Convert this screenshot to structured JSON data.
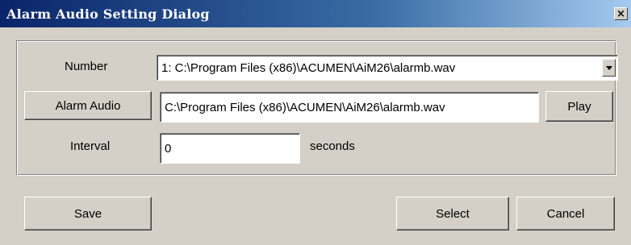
{
  "window": {
    "title": "Alarm Audio Setting Dialog",
    "close_glyph": "×",
    "close_icon": "close-icon"
  },
  "form": {
    "number_label": "Number",
    "number_selected": "1: C:\\Program Files (x86)\\ACUMEN\\AiM26\\alarmb.wav",
    "dropdown_icon": "chevron-down-icon",
    "alarm_audio_button": "Alarm Audio",
    "alarm_audio_path": "C:\\Program Files (x86)\\ACUMEN\\AiM26\\alarmb.wav",
    "play_button": "Play",
    "interval_label": "Interval",
    "interval_value": "0",
    "interval_unit": "seconds"
  },
  "footer": {
    "save_button": "Save",
    "select_button": "Select",
    "cancel_button": "Cancel"
  },
  "colors": {
    "face": "#d4d0c8",
    "title_start": "#0a246a",
    "title_end": "#a6caf0",
    "title_text": "#ffffff"
  }
}
